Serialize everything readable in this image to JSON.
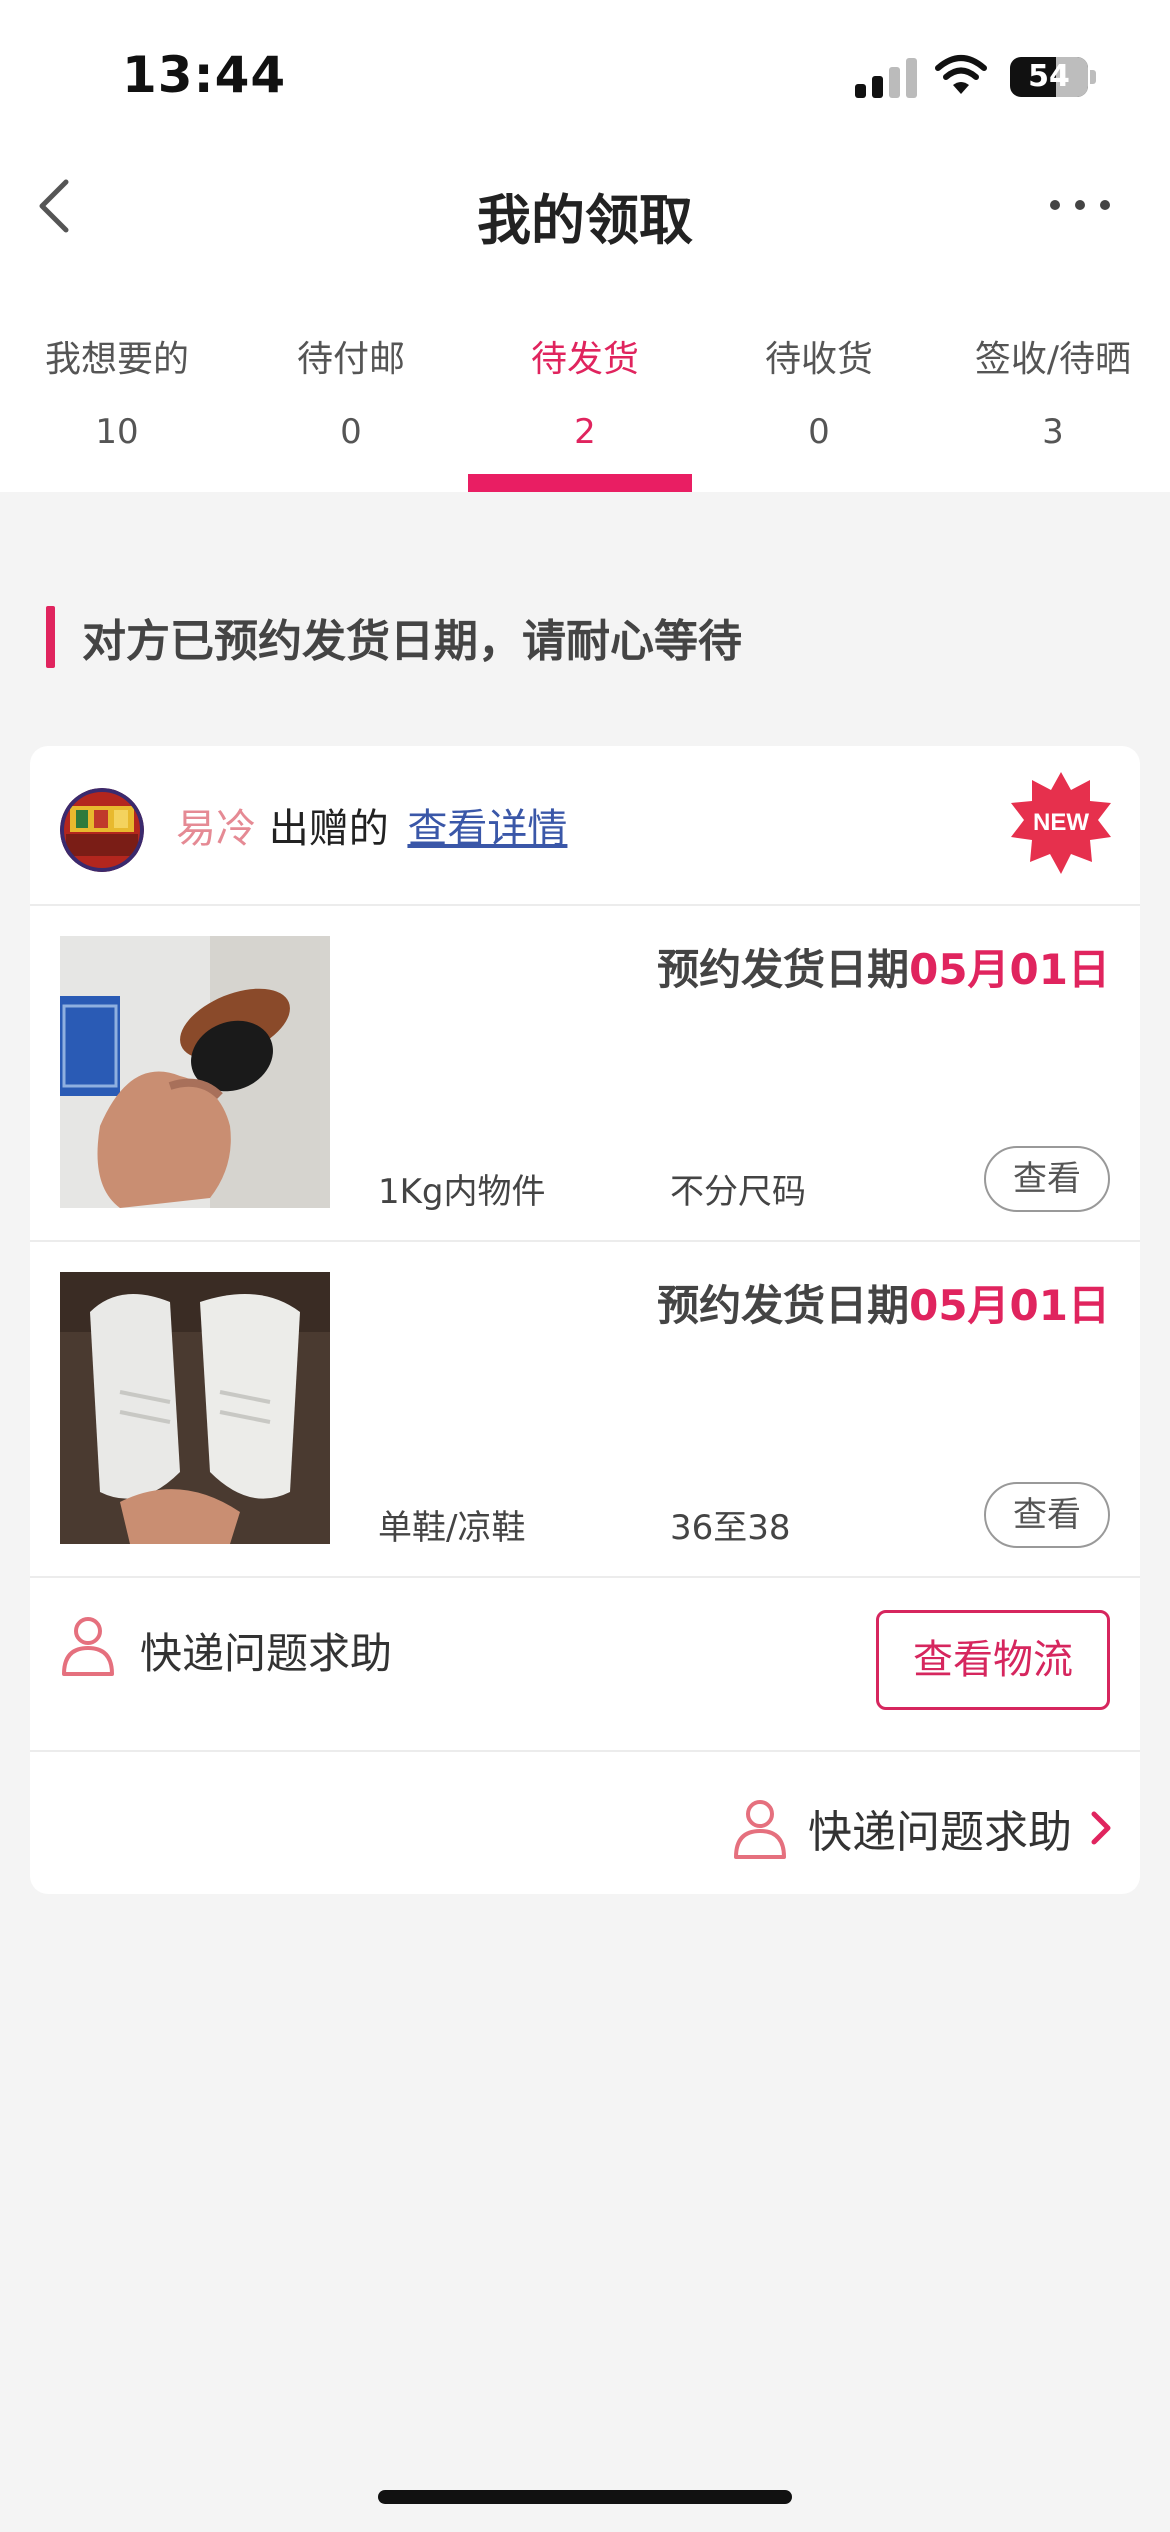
{
  "status_bar": {
    "time": "13:44",
    "battery": "54"
  },
  "navbar": {
    "title": "我的领取"
  },
  "tabs": [
    {
      "label": "我想要的",
      "count": "10"
    },
    {
      "label": "待付邮",
      "count": "0"
    },
    {
      "label": "待发货",
      "count": "2",
      "active": true
    },
    {
      "label": "待收货",
      "count": "0"
    },
    {
      "label": "签收/待晒",
      "count": "3"
    }
  ],
  "notice": {
    "text": "对方已预约发货日期，请耐心等待"
  },
  "card": {
    "giver_name": "易冷",
    "giver_suffix": "出赠的",
    "detail_link": "查看详情",
    "badge": "NEW",
    "items": [
      {
        "date_prefix": "预约发货日期",
        "date_value": "05月01日",
        "category": "1Kg内物件",
        "size": "不分尺码",
        "view_label": "查看"
      },
      {
        "date_prefix": "预约发货日期",
        "date_value": "05月01日",
        "category": "单鞋/凉鞋",
        "size": "36至38",
        "view_label": "查看"
      }
    ],
    "help_label": "快递问题求助",
    "logistics_button": "查看物流",
    "footer_help_label": "快递问题求助"
  },
  "colors": {
    "accent": "#e0245e",
    "link": "#3a57a8",
    "giver_name": "#e58a94"
  },
  "icons": [
    "back-chevron-icon",
    "more-dots-icon",
    "person-outline-icon",
    "chevron-right-icon",
    "new-badge-icon"
  ]
}
